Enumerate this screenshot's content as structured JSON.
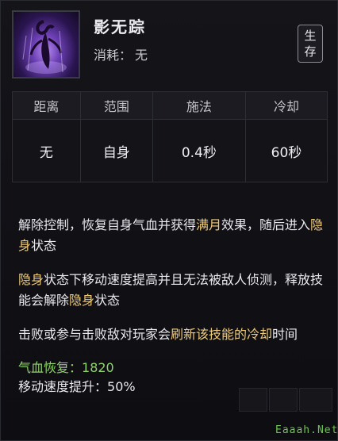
{
  "skill": {
    "name": "影无踪",
    "cost_label": "消耗",
    "cost_value": "无",
    "type_tag": [
      "生",
      "存"
    ],
    "icon": "shadow-figure-icon"
  },
  "stats": {
    "headers": [
      "距离",
      "范围",
      "施法",
      "冷却"
    ],
    "values": [
      "无",
      "自身",
      "0.4秒",
      "60秒"
    ]
  },
  "description": {
    "p1": {
      "a": "解除控制，恢复自身气血并获得",
      "hl1": "满月",
      "b": "效果，随后进入",
      "hl2": "隐身",
      "c": "状态"
    },
    "p2": {
      "hl1": "隐身",
      "a": "状态下移动速度提高并且无法被敌人侦测，释放技能会解除",
      "hl2": "隐身",
      "b": "状态"
    },
    "p3": {
      "a": "击败或参与击败敌对玩家会",
      "hl1": "刷新该技能的冷却",
      "b": "时间"
    },
    "effects": [
      {
        "label": "气血恢复：",
        "value": "1820"
      },
      {
        "label": "移动速度提升：",
        "value": "50%"
      }
    ]
  },
  "watermark": "Eaaah.Net",
  "colors": {
    "highlight": "#f0cc7a",
    "effect_green": "#8fd36a",
    "background": "#111116"
  }
}
